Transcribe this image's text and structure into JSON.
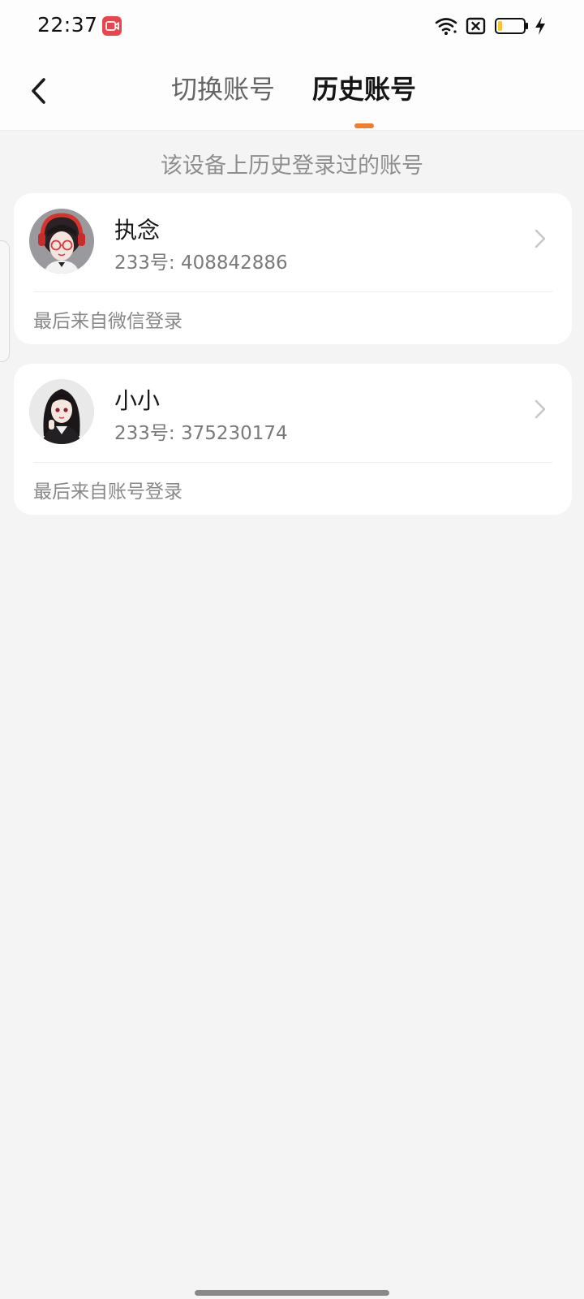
{
  "status_bar": {
    "time": "22:37",
    "icons": [
      "screen-record-icon",
      "wifi-icon",
      "sim-error-icon",
      "battery-icon",
      "charging-icon"
    ],
    "battery_level": 0.15
  },
  "header": {
    "back_icon": "chevron-left-icon",
    "tabs": [
      {
        "label": "切换账号",
        "active": false
      },
      {
        "label": "历史账号",
        "active": true
      }
    ],
    "accent_color": "#f17d2b"
  },
  "subtitle": "该设备上历史登录过的账号",
  "accounts": [
    {
      "name": "执念",
      "id_text": "233号: 408842886",
      "login_source": "最后来自微信登录",
      "avatar_icon": "avatar-girl-headphones"
    },
    {
      "name": "小小",
      "id_text": "233号: 375230174",
      "login_source": "最后来自账号登录",
      "avatar_icon": "avatar-girl-dark-hair"
    }
  ]
}
